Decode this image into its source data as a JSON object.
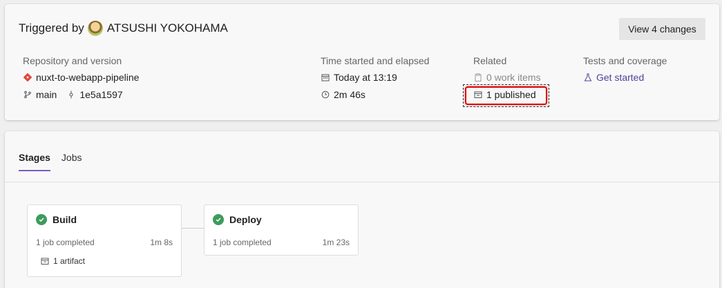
{
  "summary": {
    "triggered_by_prefix": "Triggered by",
    "user_name": "ATSUSHI YOKOHAMA",
    "view_changes_label": "View 4 changes",
    "repo": {
      "label": "Repository and version",
      "repo_name": "nuxt-to-webapp-pipeline",
      "branch": "main",
      "commit": "1e5a1597"
    },
    "time": {
      "label": "Time started and elapsed",
      "started": "Today at 13:19",
      "elapsed": "2m 46s"
    },
    "related": {
      "label": "Related",
      "work_items": "0 work items",
      "published": "1 published"
    },
    "tests": {
      "label": "Tests and coverage",
      "get_started": "Get started"
    }
  },
  "tabs": [
    {
      "label": "Stages",
      "active": true
    },
    {
      "label": "Jobs",
      "active": false
    }
  ],
  "stages": [
    {
      "name": "Build",
      "status": "1 job completed",
      "duration": "1m 8s",
      "artifact": "1 artifact"
    },
    {
      "name": "Deploy",
      "status": "1 job completed",
      "duration": "1m 23s"
    }
  ],
  "colors": {
    "accent": "#4f3f98",
    "success": "#3d9b5c",
    "highlight": "#dd0000"
  }
}
